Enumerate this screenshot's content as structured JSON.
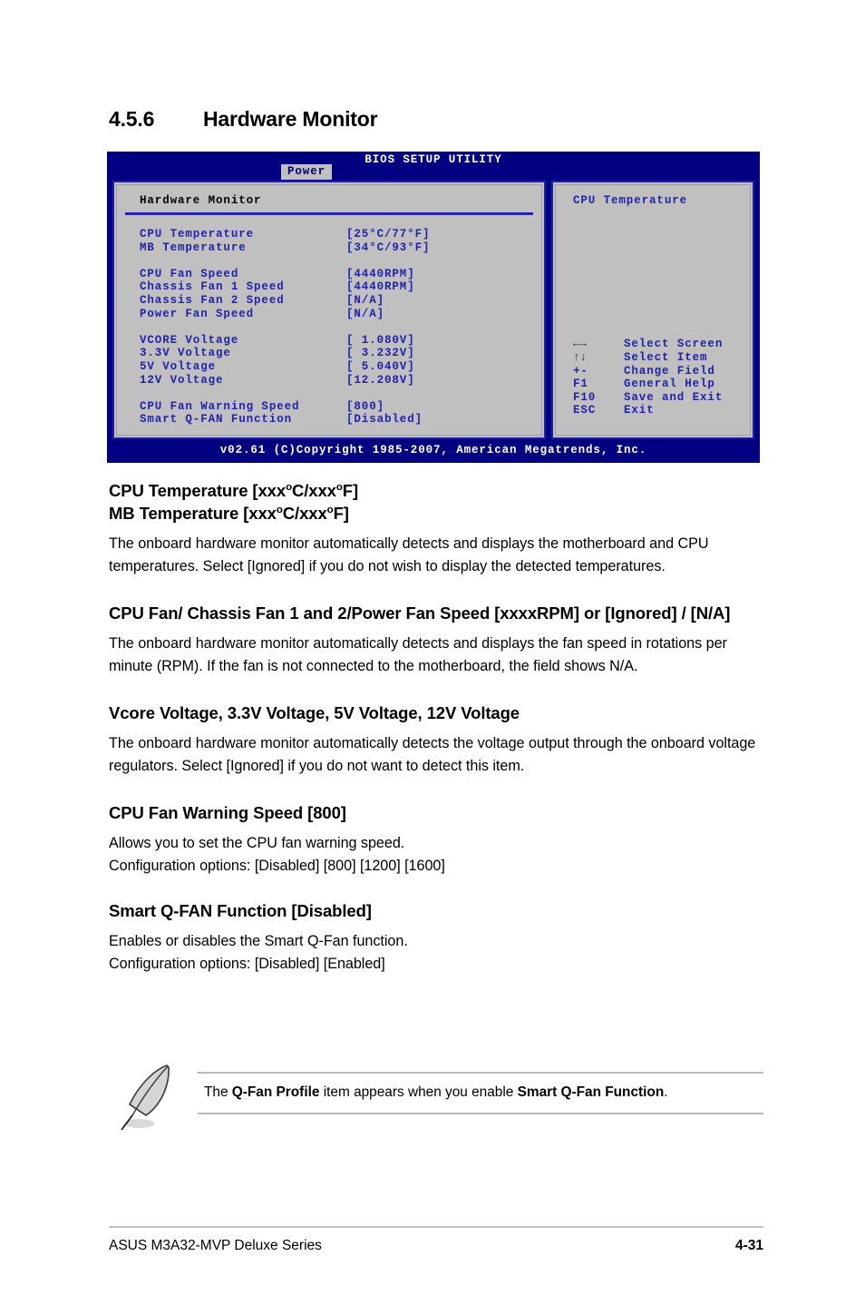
{
  "section": {
    "number": "4.5.6",
    "title": "Hardware Monitor"
  },
  "bios": {
    "title": "BIOS SETUP UTILITY",
    "tab": "Power",
    "panel_title": "Hardware Monitor",
    "help_title": "CPU Temperature",
    "footer": "v02.61 (C)Copyright 1985-2007, American Megatrends, Inc.",
    "groups": [
      {
        "rows": [
          {
            "label": "CPU Temperature",
            "value": "[25°C/77°F]"
          },
          {
            "label": "MB Temperature",
            "value": "[34°C/93°F]"
          }
        ]
      },
      {
        "rows": [
          {
            "label": "CPU Fan Speed",
            "value": "[4440RPM]"
          },
          {
            "label": "Chassis Fan 1 Speed",
            "value": "[4440RPM]"
          },
          {
            "label": "Chassis Fan 2 Speed",
            "value": "[N/A]"
          },
          {
            "label": "Power Fan Speed",
            "value": "[N/A]"
          }
        ]
      },
      {
        "rows": [
          {
            "label": "VCORE Voltage",
            "value": "[ 1.080V]"
          },
          {
            "label": "3.3V Voltage",
            "value": "[ 3.232V]"
          },
          {
            "label": "5V Voltage",
            "value": "[ 5.040V]"
          },
          {
            "label": "12V Voltage",
            "value": "[12.208V]"
          }
        ]
      },
      {
        "rows": [
          {
            "label": "CPU Fan Warning Speed",
            "value": "[800]"
          },
          {
            "label": "Smart Q-FAN Function",
            "value": "[Disabled]"
          }
        ]
      }
    ],
    "legend": [
      {
        "key": "←→",
        "glyph": true,
        "label": "Select Screen",
        "icon": "left-right-arrow-icon"
      },
      {
        "key": "↑↓",
        "glyph": true,
        "label": "Select Item",
        "icon": "up-down-arrow-icon"
      },
      {
        "key": "+-",
        "glyph": false,
        "label": "Change Field",
        "icon": "plus-minus-key-icon"
      },
      {
        "key": "F1",
        "glyph": false,
        "label": "General Help",
        "icon": "f1-key-icon"
      },
      {
        "key": "F10",
        "glyph": false,
        "label": "Save and Exit",
        "icon": "f10-key-icon"
      },
      {
        "key": "ESC",
        "glyph": false,
        "label": "Exit",
        "icon": "esc-key-icon"
      }
    ]
  },
  "sections": {
    "temperature": {
      "heading_line1_a": "CPU Temperature [xxx",
      "heading_line1_b": "C/xxx",
      "heading_line1_c": "F]",
      "heading_line2_a": "MB Temperature [xxx",
      "heading_line2_b": "C/xxx",
      "heading_line2_c": "F]",
      "deg": "o",
      "body": "The onboard hardware monitor automatically detects and displays the motherboard and CPU temperatures. Select [Ignored] if you do not wish to display the detected temperatures."
    },
    "fan_speed": {
      "heading": "CPU Fan/ Chassis Fan 1 and 2/Power Fan Speed [xxxxRPM] or [Ignored] / [N/A]",
      "body": "The onboard hardware monitor automatically detects and displays the fan speed in rotations per minute (RPM). If the fan is not connected to the motherboard, the field shows N/A."
    },
    "voltage": {
      "heading": "Vcore Voltage, 3.3V Voltage, 5V Voltage, 12V Voltage",
      "body": "The onboard hardware monitor automatically detects the voltage output through the onboard voltage regulators. Select [Ignored] if you do not want to detect this item."
    },
    "fan_warning": {
      "heading": "CPU Fan Warning Speed [800]",
      "body_line1": "Allows you to set the CPU fan warning speed.",
      "body_line2": "Configuration options: [Disabled] [800] [1200] [1600]"
    },
    "qfan": {
      "heading": "Smart Q-FAN Function [Disabled]",
      "body_line1": "Enables or disables the Smart Q-Fan function.",
      "body_line2": "Configuration options: [Disabled] [Enabled]"
    }
  },
  "note": {
    "icon": "quill-pen-icon",
    "text_a": "The ",
    "text_b": "Q-Fan Profile",
    "text_c": " item appears when you enable ",
    "text_d": "Smart Q-Fan Function",
    "text_e": "."
  },
  "footer": {
    "left": "ASUS M3A32-MVP Deluxe Series",
    "right": "4-31"
  },
  "colors": {
    "bios_blue": "#000080",
    "bios_gray": "#c0c0c0",
    "bios_text_blue": "#2222aa",
    "rule_gray": "#c3c3c3"
  }
}
